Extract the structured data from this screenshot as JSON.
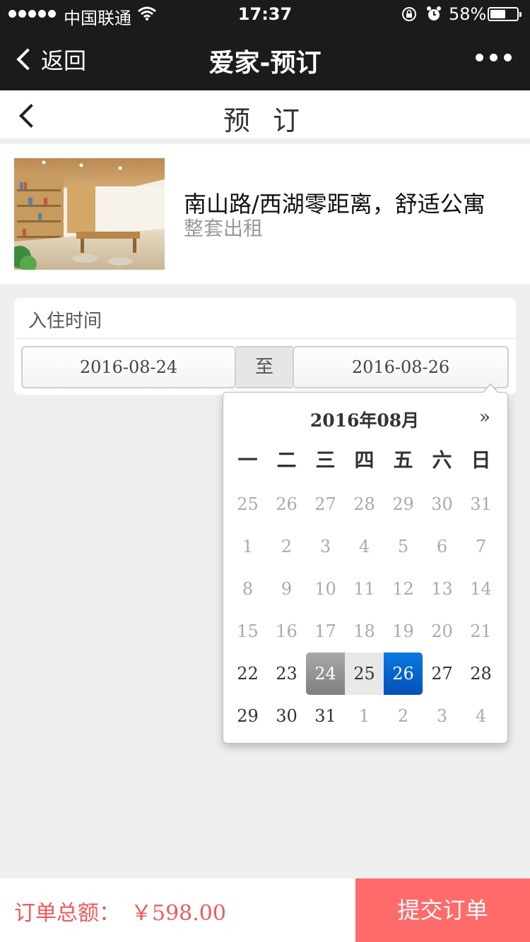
{
  "status_bar": {
    "carrier": "中国联通",
    "time": "17:37",
    "battery_percent": "58%",
    "battery_level": 0.58
  },
  "wechat_bar": {
    "back_label": "返回",
    "title": "爱家-预订"
  },
  "page": {
    "title": "预 订"
  },
  "listing": {
    "title": "南山路/西湖零距离，舒适公寓",
    "subtitle": "整套出租"
  },
  "booking": {
    "section_label": "入住时间",
    "check_in": "2016-08-24",
    "separator": "至",
    "check_out": "2016-08-26"
  },
  "calendar": {
    "month_title": "2016年08月",
    "next_label": "»",
    "weekdays": [
      "一",
      "二",
      "三",
      "四",
      "五",
      "六",
      "日"
    ],
    "weeks": [
      [
        {
          "d": "25",
          "muted": true
        },
        {
          "d": "26",
          "muted": true
        },
        {
          "d": "27",
          "muted": true
        },
        {
          "d": "28",
          "muted": true
        },
        {
          "d": "29",
          "muted": true
        },
        {
          "d": "30",
          "muted": true
        },
        {
          "d": "31",
          "muted": true
        }
      ],
      [
        {
          "d": "1",
          "muted": true
        },
        {
          "d": "2",
          "muted": true
        },
        {
          "d": "3",
          "muted": true
        },
        {
          "d": "4",
          "muted": true
        },
        {
          "d": "5",
          "muted": true
        },
        {
          "d": "6",
          "muted": true
        },
        {
          "d": "7",
          "muted": true
        }
      ],
      [
        {
          "d": "8",
          "muted": true
        },
        {
          "d": "9",
          "muted": true
        },
        {
          "d": "10",
          "muted": true
        },
        {
          "d": "11",
          "muted": true
        },
        {
          "d": "12",
          "muted": true
        },
        {
          "d": "13",
          "muted": true
        },
        {
          "d": "14",
          "muted": true
        }
      ],
      [
        {
          "d": "15",
          "muted": true
        },
        {
          "d": "16",
          "muted": true
        },
        {
          "d": "17",
          "muted": true
        },
        {
          "d": "18",
          "muted": true
        },
        {
          "d": "19",
          "muted": true
        },
        {
          "d": "20",
          "muted": true
        },
        {
          "d": "21",
          "muted": true
        }
      ],
      [
        {
          "d": "22"
        },
        {
          "d": "23"
        },
        {
          "d": "24",
          "state": "start"
        },
        {
          "d": "25",
          "state": "range"
        },
        {
          "d": "26",
          "state": "end"
        },
        {
          "d": "27"
        },
        {
          "d": "28"
        }
      ],
      [
        {
          "d": "29"
        },
        {
          "d": "30"
        },
        {
          "d": "31"
        },
        {
          "d": "1",
          "muted": true
        },
        {
          "d": "2",
          "muted": true
        },
        {
          "d": "3",
          "muted": true
        },
        {
          "d": "4",
          "muted": true
        }
      ]
    ]
  },
  "footer": {
    "total_label": "订单总额：",
    "total_amount": "￥598.00",
    "submit_label": "提交订单"
  },
  "colors": {
    "accent": "#ff6b6b",
    "price": "#f05a5a",
    "selected_end": "#0a63cc",
    "selected_start": "#8e8e8e"
  }
}
